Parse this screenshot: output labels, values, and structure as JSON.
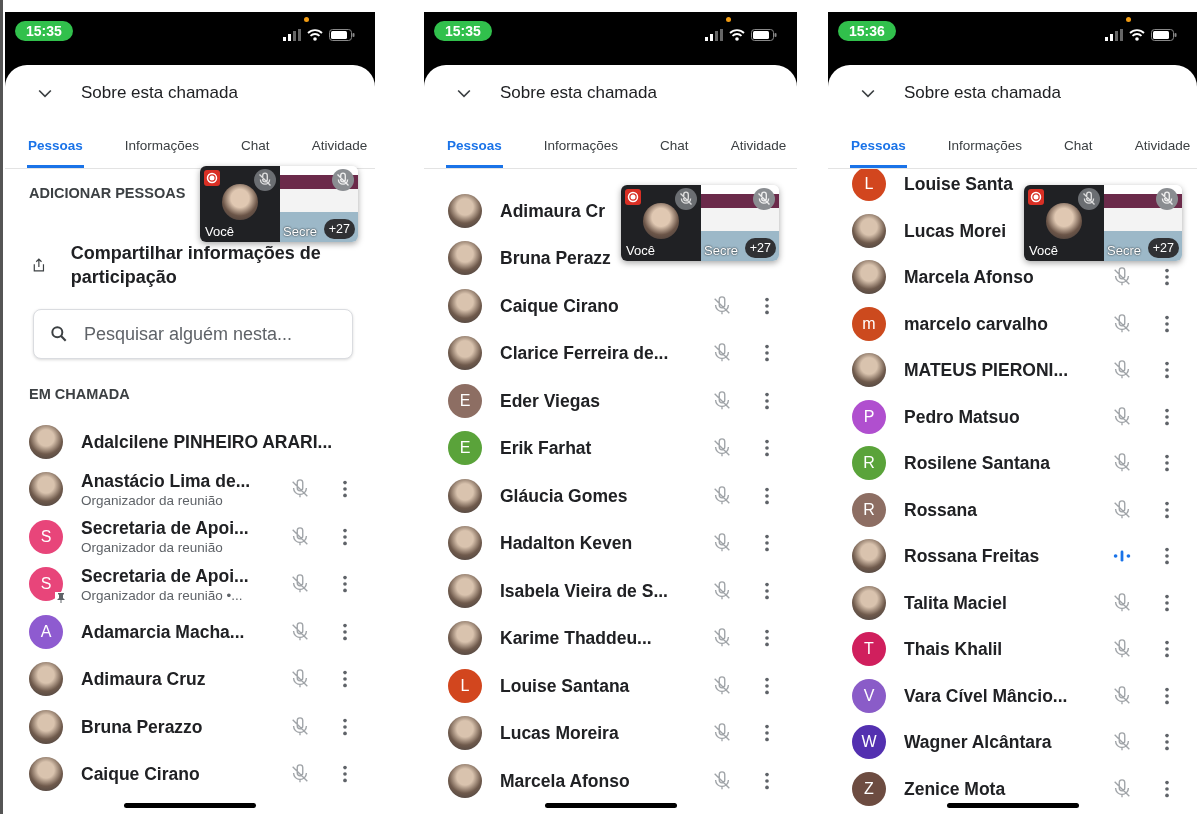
{
  "screens": [
    {
      "time": "15:35",
      "title": "Sobre esta chamada",
      "tabs": [
        {
          "label": "Pessoas",
          "selected": true
        },
        {
          "label": "Informações",
          "selected": false
        },
        {
          "label": "Chat",
          "selected": false
        },
        {
          "label": "Atividade",
          "selected": false
        }
      ],
      "tile": {
        "self_label": "Você",
        "share_label": "Secre",
        "count": "+27"
      },
      "items": [
        {
          "kind": "heading",
          "text": "ADICIONAR PESSOAS"
        },
        {
          "kind": "action",
          "text": "Compartilhar informações de participação"
        },
        {
          "kind": "search",
          "placeholder": "Pesquisar alguém nesta..."
        },
        {
          "kind": "heading",
          "text": "EM CHAMADA"
        },
        {
          "kind": "person",
          "name": "Adalcilene PINHEIRO ARARI...",
          "avatar": {
            "kind": "photo"
          },
          "pinned": false,
          "menu": false
        },
        {
          "kind": "person",
          "name": "Anastácio Lima de...",
          "subtitle": "Organizador da reunião",
          "avatar": {
            "kind": "photo"
          },
          "pinned": false,
          "mic": {
            "kind": "muted"
          },
          "menu": true
        },
        {
          "kind": "person",
          "name": "Secretaria de Apoi...",
          "subtitle": "Organizador da reunião",
          "avatar": {
            "kind": "initial",
            "initial": "S",
            "color": "#e8457a"
          },
          "pinned": false,
          "mic": {
            "kind": "muted"
          },
          "menu": true
        },
        {
          "kind": "person",
          "name": "Secretaria de Apoi...",
          "subtitle": "Organizador da reunião •...",
          "avatar": {
            "kind": "initial",
            "initial": "S",
            "color": "#e8457a"
          },
          "pinned": true,
          "mic": {
            "kind": "muted"
          },
          "menu": true
        },
        {
          "kind": "person",
          "name": "Adamarcia Macha...",
          "avatar": {
            "kind": "initial",
            "initial": "A",
            "color": "#8e5bd0"
          },
          "pinned": false,
          "mic": {
            "kind": "muted"
          },
          "menu": true
        },
        {
          "kind": "person",
          "name": "Adimaura Cruz",
          "avatar": {
            "kind": "photo"
          },
          "pinned": false,
          "mic": {
            "kind": "muted"
          },
          "menu": true
        },
        {
          "kind": "person",
          "name": "Bruna Perazzo",
          "avatar": {
            "kind": "photo"
          },
          "pinned": false,
          "mic": {
            "kind": "muted"
          },
          "menu": true
        },
        {
          "kind": "person",
          "name": "Caique Cirano",
          "avatar": {
            "kind": "photo"
          },
          "pinned": false,
          "mic": {
            "kind": "muted"
          },
          "menu": true
        }
      ]
    },
    {
      "time": "15:35",
      "title": "Sobre esta chamada",
      "tabs": [
        {
          "label": "Pessoas",
          "selected": true
        },
        {
          "label": "Informações",
          "selected": false
        },
        {
          "label": "Chat",
          "selected": false
        },
        {
          "label": "Atividade",
          "selected": false
        }
      ],
      "tile": {
        "self_label": "Você",
        "share_label": "Secre",
        "count": "+27"
      },
      "items": [
        {
          "kind": "person",
          "name": "Adimaura Cr",
          "avatar": {
            "kind": "photo"
          },
          "pinned": false,
          "menu": false
        },
        {
          "kind": "person",
          "name": "Bruna Perazz",
          "avatar": {
            "kind": "photo"
          },
          "pinned": false,
          "menu": false
        },
        {
          "kind": "person",
          "name": "Caique Cirano",
          "avatar": {
            "kind": "photo"
          },
          "pinned": false,
          "mic": {
            "kind": "muted"
          },
          "menu": true
        },
        {
          "kind": "person",
          "name": "Clarice Ferreira de...",
          "avatar": {
            "kind": "photo"
          },
          "pinned": false,
          "mic": {
            "kind": "muted"
          },
          "menu": true
        },
        {
          "kind": "person",
          "name": "Eder Viegas",
          "avatar": {
            "kind": "initial",
            "initial": "E",
            "color": "#8d6e63"
          },
          "pinned": false,
          "mic": {
            "kind": "muted"
          },
          "menu": true
        },
        {
          "kind": "person",
          "name": "Erik Farhat",
          "avatar": {
            "kind": "initial",
            "initial": "E",
            "color": "#5aa33a"
          },
          "pinned": false,
          "mic": {
            "kind": "muted"
          },
          "menu": true
        },
        {
          "kind": "person",
          "name": "Gláucia Gomes",
          "avatar": {
            "kind": "photo"
          },
          "pinned": false,
          "mic": {
            "kind": "muted"
          },
          "menu": true
        },
        {
          "kind": "person",
          "name": "Hadalton Keven",
          "avatar": {
            "kind": "photo"
          },
          "pinned": false,
          "mic": {
            "kind": "muted"
          },
          "menu": true
        },
        {
          "kind": "person",
          "name": "Isabela Vieira de S...",
          "avatar": {
            "kind": "photo"
          },
          "pinned": false,
          "mic": {
            "kind": "muted"
          },
          "menu": true
        },
        {
          "kind": "person",
          "name": "Karime Thaddeu...",
          "avatar": {
            "kind": "photo"
          },
          "pinned": false,
          "mic": {
            "kind": "muted"
          },
          "menu": true
        },
        {
          "kind": "person",
          "name": "Louise Santana",
          "avatar": {
            "kind": "initial",
            "initial": "L",
            "color": "#d2461e"
          },
          "pinned": false,
          "mic": {
            "kind": "muted"
          },
          "menu": true
        },
        {
          "kind": "person",
          "name": "Lucas Moreira",
          "avatar": {
            "kind": "photo"
          },
          "pinned": false,
          "mic": {
            "kind": "muted"
          },
          "menu": true
        },
        {
          "kind": "person",
          "name": "Marcela Afonso",
          "avatar": {
            "kind": "photo"
          },
          "pinned": false,
          "mic": {
            "kind": "muted"
          },
          "menu": true
        }
      ]
    },
    {
      "time": "15:36",
      "title": "Sobre esta chamada",
      "tabs": [
        {
          "label": "Pessoas",
          "selected": true
        },
        {
          "label": "Informações",
          "selected": false
        },
        {
          "label": "Chat",
          "selected": false
        },
        {
          "label": "Atividade",
          "selected": false
        }
      ],
      "tile": {
        "self_label": "Você",
        "share_label": "Secre",
        "count": "+27"
      },
      "items": [
        {
          "kind": "person",
          "name": "Louise Santa",
          "avatar": {
            "kind": "initial",
            "initial": "L",
            "color": "#d2461e"
          },
          "pinned": false,
          "menu": false
        },
        {
          "kind": "person",
          "name": "Lucas Morei",
          "avatar": {
            "kind": "photo"
          },
          "pinned": false,
          "menu": false
        },
        {
          "kind": "person",
          "name": "Marcela Afonso",
          "avatar": {
            "kind": "photo"
          },
          "pinned": false,
          "mic": {
            "kind": "muted"
          },
          "menu": true
        },
        {
          "kind": "person",
          "name": "marcelo carvalho",
          "avatar": {
            "kind": "initial",
            "initial": "m",
            "color": "#cc4a1e"
          },
          "pinned": false,
          "mic": {
            "kind": "muted"
          },
          "menu": true
        },
        {
          "kind": "person",
          "name": "MATEUS PIERONI...",
          "avatar": {
            "kind": "photo"
          },
          "pinned": false,
          "mic": {
            "kind": "muted"
          },
          "menu": true
        },
        {
          "kind": "person",
          "name": "Pedro Matsuo",
          "avatar": {
            "kind": "initial",
            "initial": "P",
            "color": "#b04fcf"
          },
          "pinned": false,
          "mic": {
            "kind": "muted"
          },
          "menu": true
        },
        {
          "kind": "person",
          "name": "Rosilene Santana",
          "avatar": {
            "kind": "initial",
            "initial": "R",
            "color": "#5aa33a"
          },
          "pinned": false,
          "mic": {
            "kind": "muted"
          },
          "menu": true
        },
        {
          "kind": "person",
          "name": "Rossana",
          "avatar": {
            "kind": "initial",
            "initial": "R",
            "color": "#8d6e63"
          },
          "pinned": false,
          "mic": {
            "kind": "muted"
          },
          "menu": true
        },
        {
          "kind": "person",
          "name": "Rossana Freitas",
          "avatar": {
            "kind": "photo"
          },
          "pinned": false,
          "mic": {
            "kind": "speaking"
          },
          "menu": true
        },
        {
          "kind": "person",
          "name": "Talita Maciel",
          "avatar": {
            "kind": "photo"
          },
          "pinned": false,
          "mic": {
            "kind": "muted"
          },
          "menu": true
        },
        {
          "kind": "person",
          "name": "Thais Khalil",
          "avatar": {
            "kind": "initial",
            "initial": "T",
            "color": "#d01f5d"
          },
          "pinned": false,
          "mic": {
            "kind": "muted"
          },
          "menu": true
        },
        {
          "kind": "person",
          "name": "Vara Cível Mâncio...",
          "avatar": {
            "kind": "initial",
            "initial": "V",
            "color": "#8a5cc8"
          },
          "pinned": false,
          "mic": {
            "kind": "muted"
          },
          "menu": true
        },
        {
          "kind": "person",
          "name": "Wagner Alcântara",
          "avatar": {
            "kind": "initial",
            "initial": "W",
            "color": "#5330b0"
          },
          "pinned": false,
          "mic": {
            "kind": "muted"
          },
          "menu": true
        },
        {
          "kind": "person",
          "name": "Zenice Mota",
          "avatar": {
            "kind": "initial",
            "initial": "Z",
            "color": "#6d4c41"
          },
          "pinned": false,
          "mic": {
            "kind": "muted"
          },
          "menu": true
        }
      ]
    }
  ]
}
